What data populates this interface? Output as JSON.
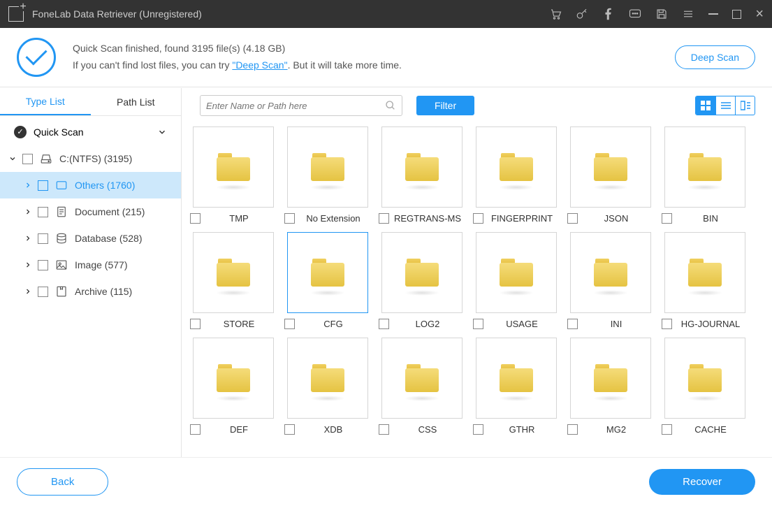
{
  "titlebar": {
    "title": "FoneLab Data Retriever (Unregistered)"
  },
  "banner": {
    "line1_prefix": "Quick Scan finished, found ",
    "file_count": "3195",
    "line1_mid": " file(s) (",
    "size": "4.18 GB",
    "line1_suffix": ")",
    "line2_prefix": "If you can't find lost files, you can try ",
    "deep_scan_link": "\"Deep Scan\"",
    "line2_suffix": ". But it will take more time.",
    "deep_scan_btn": "Deep Scan"
  },
  "toolbar": {
    "search_placeholder": "Enter Name or Path here",
    "filter": "Filter"
  },
  "sidebar": {
    "tabs": [
      "Type List",
      "Path List"
    ],
    "root": "Quick Scan",
    "drive": "C:(NTFS) (3195)",
    "items": [
      {
        "name": "Others (1760)",
        "selected": true
      },
      {
        "name": "Document (215)",
        "selected": false
      },
      {
        "name": "Database (528)",
        "selected": false
      },
      {
        "name": "Image (577)",
        "selected": false
      },
      {
        "name": "Archive (115)",
        "selected": false
      }
    ]
  },
  "folders": [
    {
      "name": "TMP"
    },
    {
      "name": "No Extension"
    },
    {
      "name": "REGTRANS-MS"
    },
    {
      "name": "FINGERPRINT"
    },
    {
      "name": "JSON"
    },
    {
      "name": "BIN"
    },
    {
      "name": "STORE"
    },
    {
      "name": "CFG",
      "selected": true
    },
    {
      "name": "LOG2"
    },
    {
      "name": "USAGE"
    },
    {
      "name": "INI"
    },
    {
      "name": "HG-JOURNAL"
    },
    {
      "name": "DEF"
    },
    {
      "name": "XDB"
    },
    {
      "name": "CSS"
    },
    {
      "name": "GTHR"
    },
    {
      "name": "MG2"
    },
    {
      "name": "CACHE"
    }
  ],
  "footer": {
    "back": "Back",
    "recover": "Recover"
  }
}
